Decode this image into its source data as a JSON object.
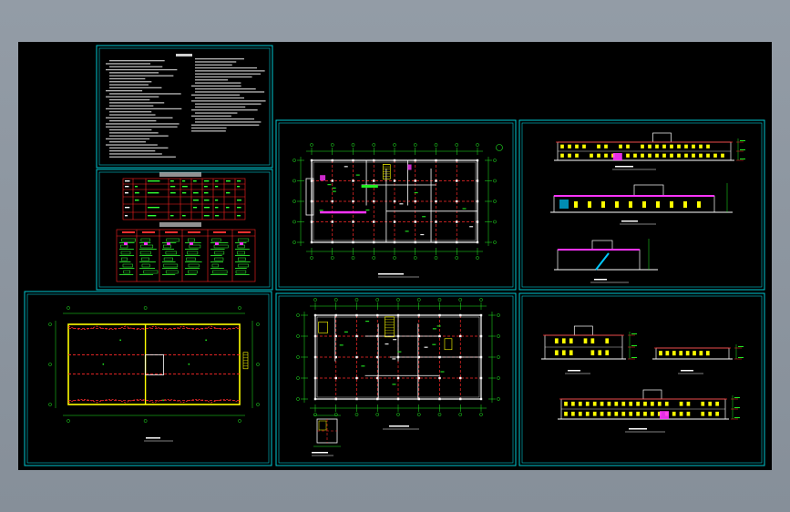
{
  "viewer": {
    "background_color": "#8d96a0",
    "canvas_color": "#000000",
    "frame_color": "#00c8d2",
    "wall_color": "#ffffff",
    "grid_color": "#ff2a2a",
    "dimension_color": "#22ee22",
    "highlight_color": "#ffff00",
    "accent_color": "#ff33ff"
  },
  "sheets": [
    {
      "id": "notes",
      "kind": "design-notes"
    },
    {
      "id": "schedule",
      "kind": "schedule-table"
    },
    {
      "id": "plan-1",
      "kind": "floor-plan"
    },
    {
      "id": "elev-1",
      "kind": "elevation-section"
    },
    {
      "id": "roof",
      "kind": "roof-plan"
    },
    {
      "id": "plan-2",
      "kind": "floor-plan"
    },
    {
      "id": "elev-2",
      "kind": "elevation"
    }
  ]
}
